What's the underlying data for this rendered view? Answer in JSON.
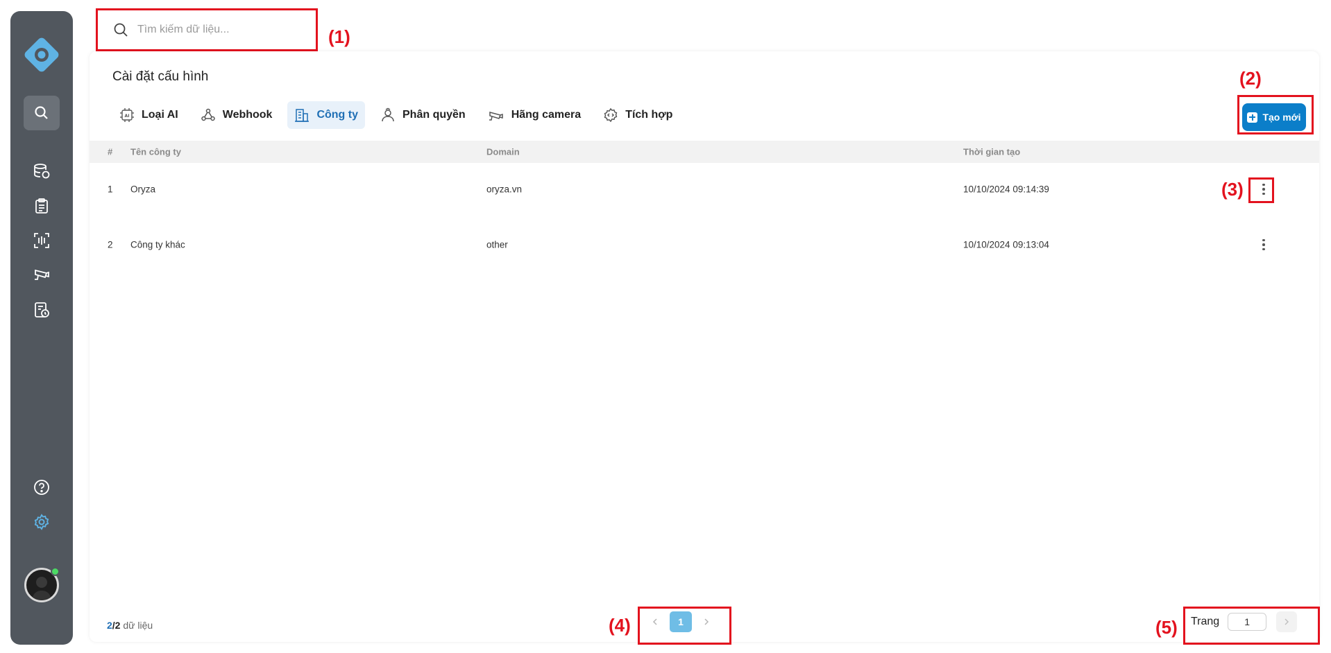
{
  "search": {
    "placeholder": "Tìm kiếm dữ liệu..."
  },
  "annotations": [
    "(1)",
    "(2)",
    "(3)",
    "(4)",
    "(5)"
  ],
  "page": {
    "title": "Cài đặt cấu hình"
  },
  "tabs": [
    {
      "label": "Loại AI",
      "icon": "ai-chip-icon"
    },
    {
      "label": "Webhook",
      "icon": "webhook-icon"
    },
    {
      "label": "Công ty",
      "icon": "building-icon",
      "active": true
    },
    {
      "label": "Phân quyền",
      "icon": "user-role-icon"
    },
    {
      "label": "Hãng camera",
      "icon": "camera-icon"
    },
    {
      "label": "Tích hợp",
      "icon": "integration-icon"
    }
  ],
  "create_button": {
    "label": "Tạo mới"
  },
  "table": {
    "columns": [
      "#",
      "Tên công ty",
      "Domain",
      "Thời gian tạo"
    ],
    "rows": [
      {
        "idx": "1",
        "name": "Oryza",
        "domain": "oryza.vn",
        "created": "10/10/2024 09:14:39"
      },
      {
        "idx": "2",
        "name": "Công ty khác",
        "domain": "other",
        "created": "10/10/2024 09:13:04"
      }
    ]
  },
  "footer": {
    "shown": "2",
    "total": "/2",
    "suffix": " dữ liệu",
    "current_page": "1",
    "goto_label": "Trang",
    "goto_value": "1"
  },
  "colors": {
    "accent": "#0b7ec9",
    "sidebar": "#51575e",
    "annotation": "#e3121e"
  }
}
